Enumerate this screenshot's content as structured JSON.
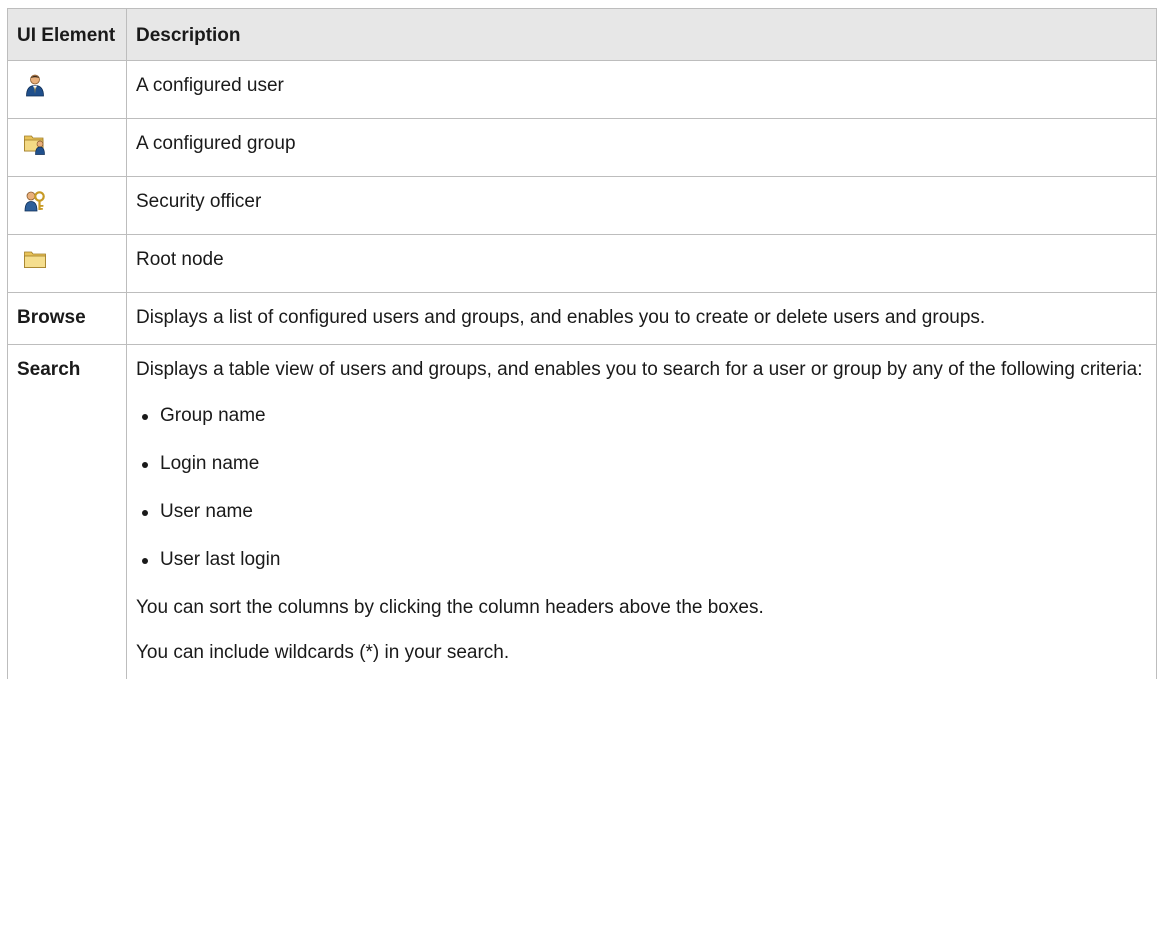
{
  "table": {
    "header": {
      "element_label": "UI Element",
      "description_label": "Description"
    },
    "icon_rows": [
      {
        "icon": "user-icon",
        "description": "A configured user"
      },
      {
        "icon": "group-folder-icon",
        "description": "A configured group"
      },
      {
        "icon": "security-officer-icon",
        "description": "Security officer"
      },
      {
        "icon": "folder-icon",
        "description": "Root node"
      }
    ],
    "browse": {
      "label": "Browse",
      "description": "Displays a list of configured users and groups, and enables you to create or delete users and groups."
    },
    "search": {
      "label": "Search",
      "description": "Displays a table view of users and groups, and enables you to search for a user or group by any of the following criteria:",
      "criteria": [
        "Group name",
        "Login name",
        "User name",
        "User last login"
      ],
      "notes": [
        "You can sort the columns by clicking the column headers above the boxes.",
        "You can include wildcards (*) in your search."
      ]
    }
  },
  "colors": {
    "header_bg": "#e7e7e7",
    "border": "#bdbdbd",
    "folder": "#e8c35a"
  }
}
